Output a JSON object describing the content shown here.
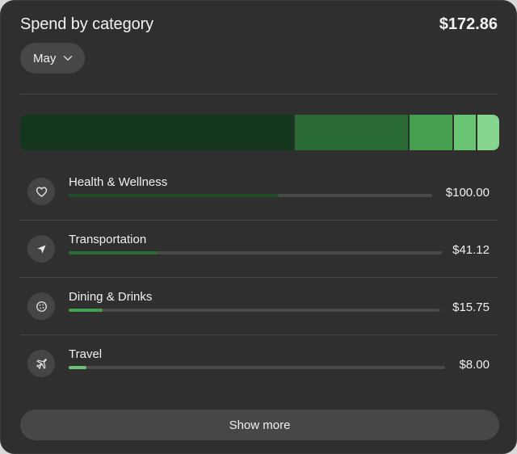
{
  "header": {
    "title": "Spend by category",
    "total": "$172.86"
  },
  "month_selector": {
    "selected": "May",
    "icon": "chevron-down-icon"
  },
  "colors": {
    "health": "#14361c",
    "transport": "#2b6b35",
    "dining": "#47a04f",
    "travel": "#69c474",
    "other": "#86d690"
  },
  "breakdown": [
    {
      "name": "health",
      "value": 100.0,
      "color": "#14361c"
    },
    {
      "name": "transport",
      "value": 41.12,
      "color": "#2b6b35"
    },
    {
      "name": "dining",
      "value": 15.75,
      "color": "#47a04f"
    },
    {
      "name": "travel",
      "value": 8.0,
      "color": "#69c474"
    },
    {
      "name": "other",
      "value": 7.99,
      "color": "#86d690"
    }
  ],
  "categories": [
    {
      "label": "Health & Wellness",
      "amount": "$100.00",
      "value": 100.0,
      "icon": "heart-icon",
      "color": "#14361c"
    },
    {
      "label": "Transportation",
      "amount": "$41.12",
      "value": 41.12,
      "icon": "navigation-arrow-icon",
      "color": "#2b6b35"
    },
    {
      "label": "Dining & Drinks",
      "amount": "$15.75",
      "value": 15.75,
      "icon": "cookie-icon",
      "color": "#47a04f"
    },
    {
      "label": "Travel",
      "amount": "$8.00",
      "value": 8.0,
      "icon": "airplane-icon",
      "color": "#69c474"
    }
  ],
  "footer": {
    "show_more_label": "Show more"
  }
}
